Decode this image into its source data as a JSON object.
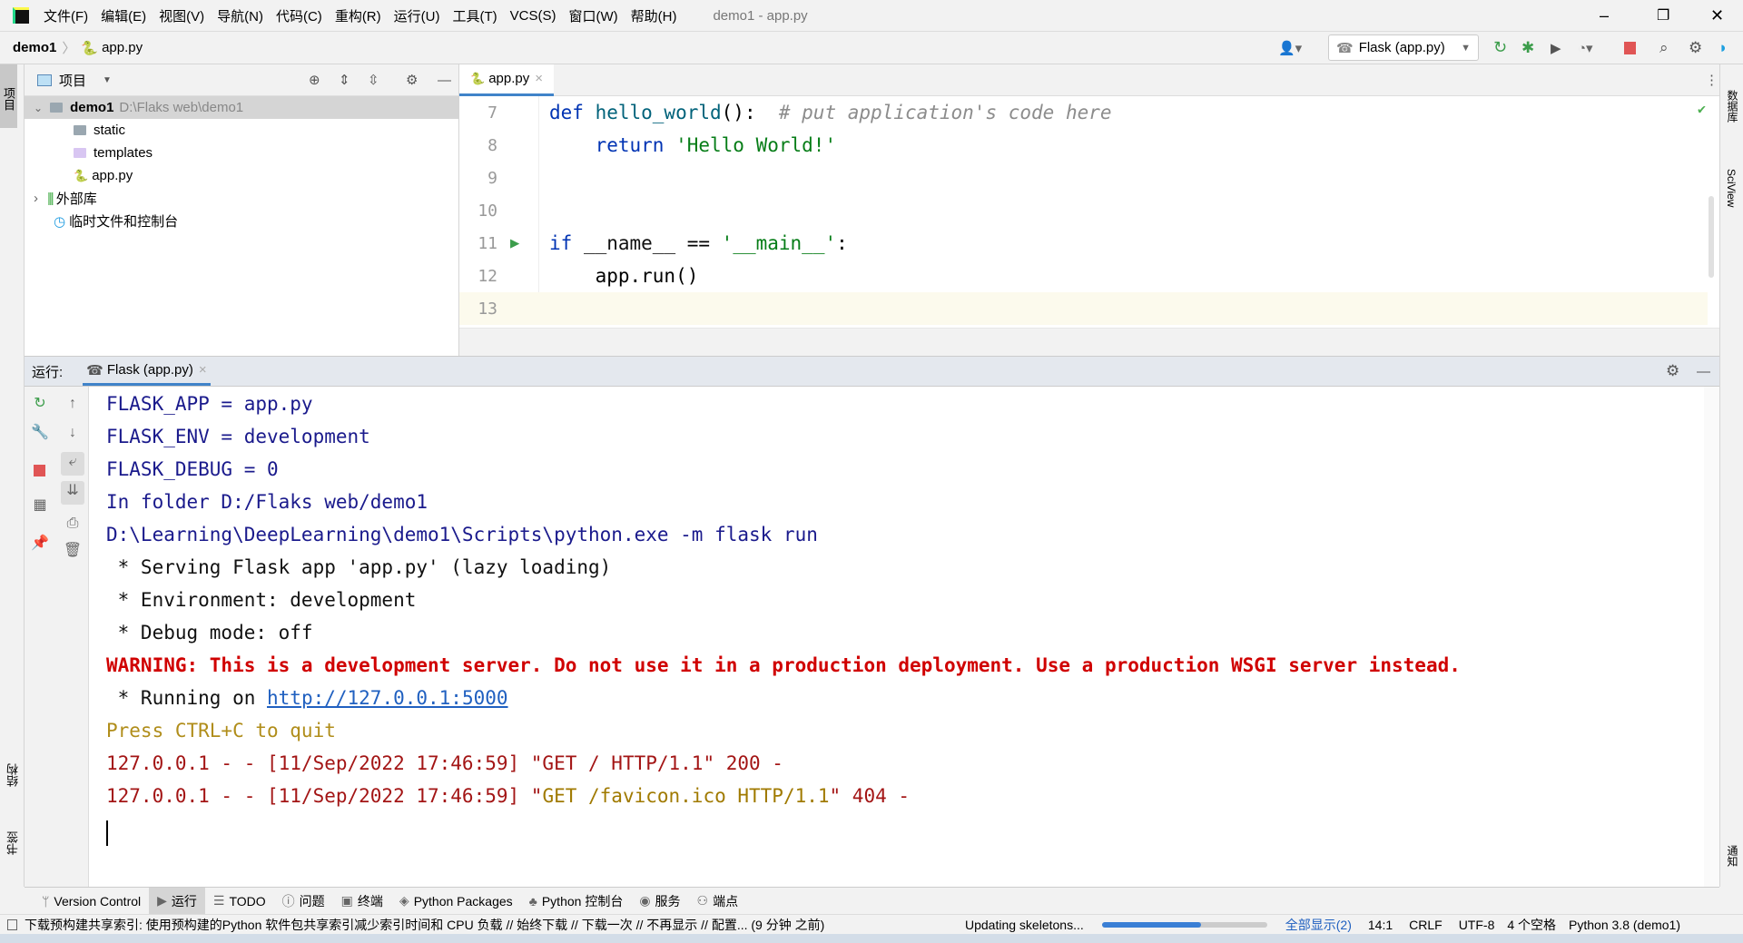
{
  "title_bar": {
    "menus": [
      "文件(F)",
      "编辑(E)",
      "视图(V)",
      "导航(N)",
      "代码(C)",
      "重构(R)",
      "运行(U)",
      "工具(T)",
      "VCS(S)",
      "窗口(W)",
      "帮助(H)"
    ],
    "window_title": "demo1 - app.py"
  },
  "nav_bar": {
    "breadcrumb": [
      "demo1",
      "app.py"
    ],
    "run_config": "Flask (app.py)"
  },
  "left_strip": {
    "project": "项目",
    "structure": "结构",
    "bookmarks": "书签"
  },
  "right_strip": {
    "database": "数据库",
    "sciview": "SciView",
    "notifications": "通知"
  },
  "project_panel": {
    "header": "项目",
    "tree": [
      {
        "name": "demo1",
        "path": "D:\\Flaks web\\demo1",
        "level": 0,
        "expanded": true
      },
      {
        "name": "static",
        "level": 1
      },
      {
        "name": "templates",
        "level": 1
      },
      {
        "name": "app.py",
        "level": 1
      },
      {
        "name": "外部库",
        "level": 0
      },
      {
        "name": "临时文件和控制台",
        "level": 0
      }
    ]
  },
  "editor": {
    "tab": "app.py",
    "lines": [
      {
        "n": "7"
      },
      {
        "n": "8"
      },
      {
        "n": "9"
      },
      {
        "n": "10"
      },
      {
        "n": "11"
      },
      {
        "n": "12"
      },
      {
        "n": "13"
      }
    ],
    "code": {
      "l7_kw": "def ",
      "l7_fn": "hello_world",
      "l7_p": "():  ",
      "l7_cm": "# put application's code here",
      "l8_kw": "    return ",
      "l8_str": "'Hello World!'",
      "l11_kw": "if ",
      "l11_dn": "__name__",
      "l11_op": " == ",
      "l11_str": "'__main__'",
      "l11_end": ":",
      "l12": "    app.run()"
    }
  },
  "run_panel": {
    "label": "运行:",
    "tab": "Flask (app.py)"
  },
  "console": {
    "lines": [
      "FLASK_APP = app.py",
      "FLASK_ENV = development",
      "FLASK_DEBUG = 0",
      "In folder D:/Flaks web/demo1",
      "D:\\Learning\\DeepLearning\\demo1\\Scripts\\python.exe -m flask run",
      " * Serving Flask app 'app.py' (lazy loading)",
      " * Environment: development",
      " * Debug mode: off",
      "WARNING: This is a development server. Do not use it in a production deployment. Use a production WSGI server instead."
    ],
    "running_prefix": " * Running on ",
    "url": "http://127.0.0.1:5000",
    "quit": "Press CTRL+C to quit",
    "log1": "127.0.0.1 - - [11/Sep/2022 17:46:59] \"GET / HTTP/1.1\" 200 -",
    "log2_a": "127.0.0.1 - - [11/Sep/2022 17:46:59] \"",
    "log2_b": "GET /favicon.ico HTTP/1.1",
    "log2_c": "\" 404 -"
  },
  "tool_tabs": [
    "Version Control",
    "运行",
    "TODO",
    "问题",
    "终端",
    "Python Packages",
    "Python 控制台",
    "服务",
    "端点"
  ],
  "status_bar": {
    "message": "下载预构建共享索引: 使用预构建的Python 软件包共享索引减少索引时间和 CPU 负载 // 始终下载 // 下载一次 // 不再显示 // 配置... (9 分钟 之前)",
    "task": "Updating skeletons...",
    "progress": 0.6,
    "show_all": "全部显示(2)",
    "position": "14:1",
    "line_sep": "CRLF",
    "encoding": "UTF-8",
    "indent": "4 个空格",
    "interpreter": "Python 3.8 (demo1)"
  },
  "colors": {
    "accent": "#4083c9",
    "keyword": "#0033b3",
    "string": "#067d17",
    "warning": "#d00000"
  }
}
